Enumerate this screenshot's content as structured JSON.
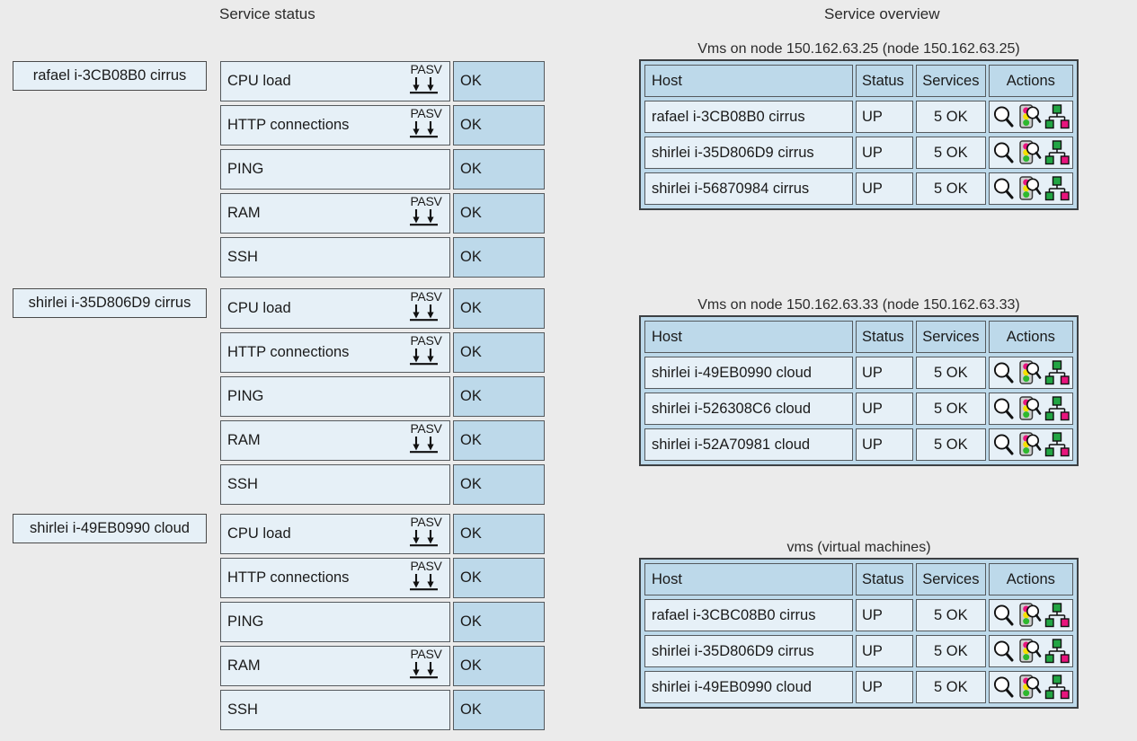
{
  "titles": {
    "service_status": "Service status",
    "service_overview": "Service overview"
  },
  "service_status": {
    "state_label": "OK",
    "pasv_label": "PASV",
    "groups": [
      {
        "host": "rafael i-3CB08B0 cirrus",
        "services": [
          {
            "name": "CPU load",
            "passive": true,
            "state": "OK"
          },
          {
            "name": "HTTP connections",
            "passive": true,
            "state": "OK"
          },
          {
            "name": "PING",
            "passive": false,
            "state": "OK"
          },
          {
            "name": "RAM",
            "passive": true,
            "state": "OK"
          },
          {
            "name": "SSH",
            "passive": false,
            "state": "OK"
          }
        ]
      },
      {
        "host": "shirlei i-35D806D9 cirrus",
        "services": [
          {
            "name": "CPU load",
            "passive": true,
            "state": "OK"
          },
          {
            "name": "HTTP connections",
            "passive": true,
            "state": "OK"
          },
          {
            "name": "PING",
            "passive": false,
            "state": "OK"
          },
          {
            "name": "RAM",
            "passive": true,
            "state": "OK"
          },
          {
            "name": "SSH",
            "passive": false,
            "state": "OK"
          }
        ]
      },
      {
        "host": "shirlei i-49EB0990 cloud",
        "services": [
          {
            "name": "CPU load",
            "passive": true,
            "state": "OK"
          },
          {
            "name": "HTTP connections",
            "passive": true,
            "state": "OK"
          },
          {
            "name": "PING",
            "passive": false,
            "state": "OK"
          },
          {
            "name": "RAM",
            "passive": true,
            "state": "OK"
          },
          {
            "name": "SSH",
            "passive": false,
            "state": "OK"
          }
        ]
      }
    ]
  },
  "service_overview": {
    "columns": [
      "Host",
      "Status",
      "Services",
      "Actions"
    ],
    "action_icons": [
      "magnifier-icon",
      "traffic-light-icon",
      "topology-tree-icon"
    ],
    "tables": [
      {
        "caption": "Vms on node 150.162.63.25 (node 150.162.63.25)",
        "rows": [
          {
            "host": "rafael i-3CB08B0 cirrus",
            "status": "UP",
            "services": "5 OK"
          },
          {
            "host": "shirlei i-35D806D9 cirrus",
            "status": "UP",
            "services": "5 OK"
          },
          {
            "host": "shirlei i-56870984 cirrus",
            "status": "UP",
            "services": "5 OK"
          }
        ]
      },
      {
        "caption": "Vms on node 150.162.63.33 (node 150.162.63.33)",
        "rows": [
          {
            "host": "shirlei i-49EB0990 cloud",
            "status": "UP",
            "services": "5 OK"
          },
          {
            "host": "shirlei i-526308C6 cloud",
            "status": "UP",
            "services": "5 OK"
          },
          {
            "host": "shirlei i-52A70981 cloud",
            "status": "UP",
            "services": "5 OK"
          }
        ]
      },
      {
        "caption": "vms (virtual machines)",
        "rows": [
          {
            "host": "rafael i-3CBC08B0 cirrus",
            "status": "UP",
            "services": "5 OK"
          },
          {
            "host": "shirlei i-35D806D9 cirrus",
            "status": "UP",
            "services": "5 OK"
          },
          {
            "host": "shirlei i-49EB0990 cloud",
            "status": "UP",
            "services": "5 OK"
          }
        ]
      }
    ]
  },
  "colors": {
    "page_background": "#ebebeb",
    "cell_light_blue": "#e6f0f7",
    "cell_mid_blue": "#bdd9ea",
    "border_dark": "#555a5e",
    "frame_dark": "#3c4043",
    "traffic_red": "#e8147d",
    "traffic_yellow": "#f5e000",
    "traffic_green": "#2eb82e",
    "node_green": "#22a544",
    "node_pink": "#e8147d"
  }
}
